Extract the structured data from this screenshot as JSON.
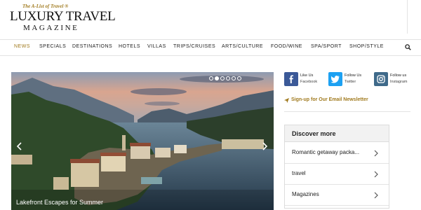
{
  "logo": {
    "tagline": "The A-List of Travel ®",
    "title": "LUXURY TRAVEL",
    "subtitle": "MAGAZINE"
  },
  "nav": {
    "items": [
      "NEWS",
      "SPECIALS",
      "DESTINATIONS",
      "HOTELS",
      "VILLAS",
      "TRIPS/CRUISES",
      "ARTS/CULTURE",
      "FOOD/WINE",
      "SPA/SPORT",
      "SHOP/STYLE"
    ],
    "active_index": 0,
    "search_icon": "search-icon"
  },
  "hero": {
    "caption": "Lakefront Escapes for Summer",
    "slide_count": 6,
    "active_slide": 1,
    "prev_icon": "chevron-left-icon",
    "next_icon": "chevron-right-icon"
  },
  "social": [
    {
      "icon": "facebook-icon",
      "line1": "Like Us",
      "line2": "Facebook",
      "color": "#3b5998"
    },
    {
      "icon": "twitter-icon",
      "line1": "Follow Us",
      "line2": "Twitter",
      "color": "#1da1f2"
    },
    {
      "icon": "instagram-icon",
      "line1": "Follow us",
      "line2": "Instagram",
      "color": "#3f6a8a"
    }
  ],
  "newsletter": {
    "label": "Sign-up for Our Email Newsletter",
    "icon": "paper-plane-icon"
  },
  "discover": {
    "title": "Discover more",
    "items": [
      "Romantic getaway packa...",
      "travel",
      "Magazines"
    ]
  },
  "colors": {
    "accent": "#a07a1e",
    "nav_text": "#222222"
  }
}
